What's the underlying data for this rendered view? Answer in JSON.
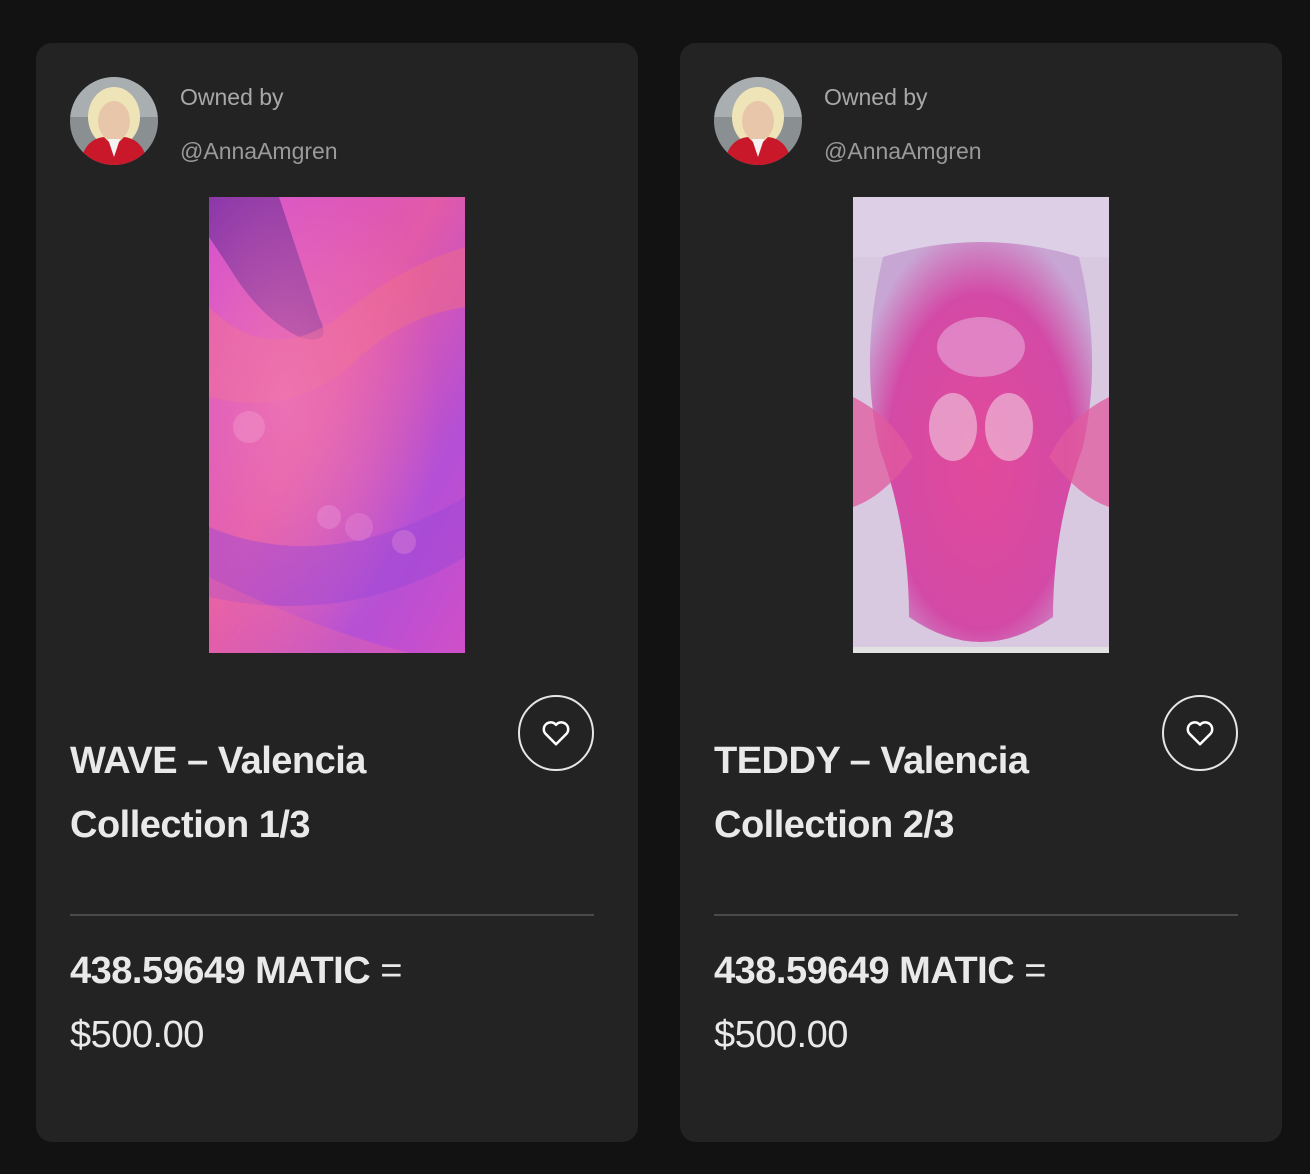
{
  "cards": [
    {
      "owned_label": "Owned by",
      "owner_handle": "@AnnaAmgren",
      "title": "WAVE – Valencia Collection 1/3",
      "price_crypto": "438.59649 MATIC",
      "price_equals": "=",
      "price_fiat": "$500.00",
      "favorite_icon": "heart-outline-icon"
    },
    {
      "owned_label": "Owned by",
      "owner_handle": "@AnnaAmgren",
      "title": "TEDDY – Valencia Collection 2/3",
      "price_crypto": "438.59649 MATIC",
      "price_equals": "=",
      "price_fiat": "$500.00",
      "favorite_icon": "heart-outline-icon"
    }
  ],
  "colors": {
    "page_background": "#121212",
    "card_background": "#232323",
    "text_primary": "#e9e9e9",
    "text_secondary": "#a8a8a8",
    "art_magenta": "#c040d0",
    "art_pink": "#e0409a"
  }
}
